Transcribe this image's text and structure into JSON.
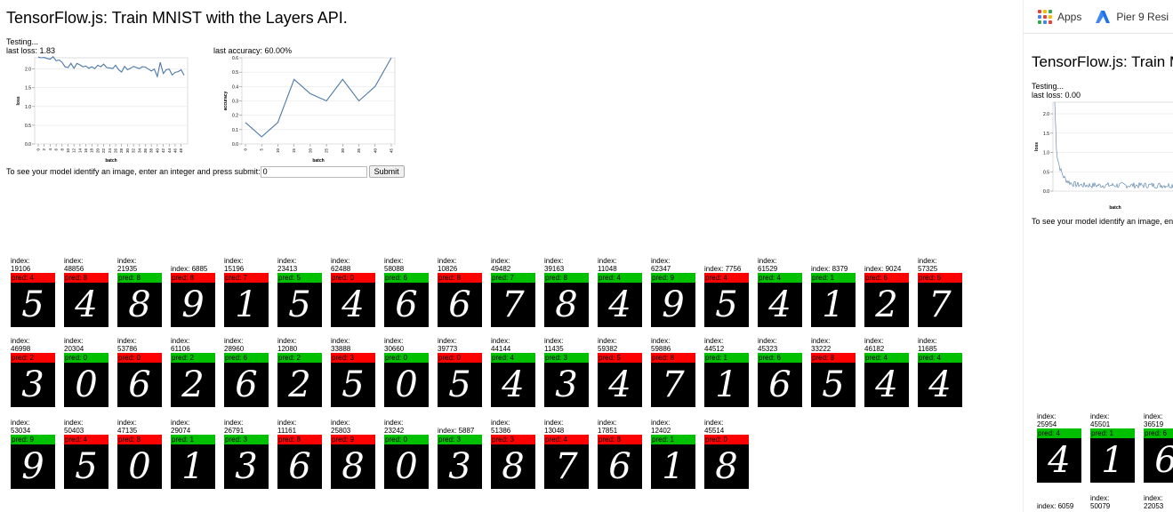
{
  "title": "TensorFlow.js: Train MNIST with the Layers API.",
  "status_text": "Testing...",
  "loss_label": "last loss: 1.83",
  "accuracy_label": "last accuracy: 60.00%",
  "prompt_text": "To see your model identify an image, enter an integer and press submit:",
  "index_input": {
    "value": "0"
  },
  "submit_label": "Submit",
  "chart_data": [
    {
      "type": "line",
      "title": "",
      "xlabel": "batch",
      "ylabel": "loss",
      "ylim": [
        0,
        2.3
      ],
      "yticks": [
        "0.0",
        "0.5",
        "1.0",
        "1.5",
        "2.0"
      ],
      "xticks": [
        "0",
        "2",
        "4",
        "6",
        "8",
        "10",
        "12",
        "14",
        "16",
        "18",
        "20",
        "22",
        "24",
        "26",
        "28",
        "30",
        "32",
        "34",
        "36",
        "38",
        "40",
        "42",
        "44",
        "46",
        "48"
      ],
      "x": [
        0,
        1,
        2,
        3,
        4,
        5,
        6,
        7,
        8,
        9,
        10,
        11,
        12,
        13,
        14,
        15,
        16,
        17,
        18,
        19,
        20,
        21,
        22,
        23,
        24,
        25,
        26,
        27,
        28,
        29,
        30,
        31,
        32,
        33,
        34,
        35,
        36,
        37,
        38,
        39,
        40,
        41,
        42,
        43,
        44,
        45,
        46,
        47,
        48,
        49
      ],
      "values": [
        2.32,
        2.3,
        2.31,
        2.28,
        2.26,
        2.33,
        2.22,
        2.24,
        2.18,
        2.06,
        2.04,
        2.15,
        2.02,
        2.15,
        2.11,
        2.06,
        2.08,
        2.02,
        2.06,
        2.01,
        2.1,
        2.06,
        2.13,
        2.04,
        2.03,
        2.01,
        2.1,
        1.98,
        1.92,
        2.07,
        1.98,
        2.02,
        2.07,
        2.04,
        2.01,
        2.06,
        2.05,
        2.0,
        1.95,
        2.0,
        1.8,
        2.18,
        1.88,
        1.98,
        2.0,
        1.84,
        1.91,
        1.93,
        1.98,
        1.83
      ]
    },
    {
      "type": "line",
      "title": "",
      "xlabel": "batch",
      "ylabel": "accuracy",
      "ylim": [
        0,
        0.6
      ],
      "yticks": [
        "0.0",
        "0.1",
        "0.2",
        "0.3",
        "0.4",
        "0.5",
        "0.6"
      ],
      "xticks": [
        "0",
        "5",
        "10",
        "15",
        "20",
        "25",
        "30",
        "35",
        "40",
        "45"
      ],
      "x": [
        0,
        5,
        10,
        15,
        20,
        25,
        30,
        35,
        40,
        45
      ],
      "values": [
        0.15,
        0.05,
        0.15,
        0.45,
        0.35,
        0.3,
        0.45,
        0.3,
        0.4,
        0.6
      ]
    },
    {
      "type": "line",
      "title": "",
      "xlabel": "batch",
      "ylabel": "loss",
      "ylim": [
        0,
        2.3
      ],
      "yticks": [
        "0.0",
        "0.5",
        "1.0",
        "1.5",
        "2.0"
      ],
      "note": ""
    }
  ],
  "examples": [
    {
      "index": "19106",
      "pred": "pred: 4",
      "correct": false,
      "digit": "5"
    },
    {
      "index": "48856",
      "pred": "pred: 8",
      "correct": false,
      "digit": "4"
    },
    {
      "index": "21935",
      "pred": "pred: 8",
      "correct": true,
      "digit": "8"
    },
    {
      "index": "6885",
      "pred": "pred: 8",
      "correct": false,
      "digit": "9"
    },
    {
      "index": "15196",
      "pred": "pred: 7",
      "correct": false,
      "digit": "1"
    },
    {
      "index": "23413",
      "pred": "pred: 5",
      "correct": true,
      "digit": "5"
    },
    {
      "index": "62488",
      "pred": "pred: 0",
      "correct": false,
      "digit": "4"
    },
    {
      "index": "58088",
      "pred": "pred: 6",
      "correct": true,
      "digit": "6"
    },
    {
      "index": "10826",
      "pred": "pred: 8",
      "correct": false,
      "digit": "6"
    },
    {
      "index": "49482",
      "pred": "pred: 7",
      "correct": true,
      "digit": "7"
    },
    {
      "index": "39163",
      "pred": "pred: 8",
      "correct": true,
      "digit": "8"
    },
    {
      "index": "11048",
      "pred": "pred: 4",
      "correct": true,
      "digit": "4"
    },
    {
      "index": "62347",
      "pred": "pred: 9",
      "correct": true,
      "digit": "9"
    },
    {
      "index": "7756",
      "pred": "pred: 4",
      "correct": false,
      "digit": "5"
    },
    {
      "index": "61529",
      "pred": "pred: 4",
      "correct": true,
      "digit": "4"
    },
    {
      "index": "8379",
      "pred": "pred: 1",
      "correct": true,
      "digit": "1"
    },
    {
      "index": "9024",
      "pred": "pred: 6",
      "correct": false,
      "digit": "2"
    },
    {
      "index": "57325",
      "pred": "pred: 6",
      "correct": false,
      "digit": "7"
    },
    {
      "index": "46998",
      "pred": "pred: 2",
      "correct": false,
      "digit": "3"
    },
    {
      "index": "20304",
      "pred": "pred: 0",
      "correct": true,
      "digit": "0"
    },
    {
      "index": "53786",
      "pred": "pred: 0",
      "correct": false,
      "digit": "6"
    },
    {
      "index": "61106",
      "pred": "pred: 2",
      "correct": true,
      "digit": "2"
    },
    {
      "index": "28960",
      "pred": "pred: 6",
      "correct": true,
      "digit": "6"
    },
    {
      "index": "12080",
      "pred": "pred: 2",
      "correct": true,
      "digit": "2"
    },
    {
      "index": "33888",
      "pred": "pred: 3",
      "correct": false,
      "digit": "5"
    },
    {
      "index": "30660",
      "pred": "pred: 0",
      "correct": true,
      "digit": "0"
    },
    {
      "index": "39773",
      "pred": "pred: 0",
      "correct": false,
      "digit": "5"
    },
    {
      "index": "44144",
      "pred": "pred: 4",
      "correct": true,
      "digit": "4"
    },
    {
      "index": "11435",
      "pred": "pred: 3",
      "correct": true,
      "digit": "3"
    },
    {
      "index": "59382",
      "pred": "pred: 5",
      "correct": false,
      "digit": "4"
    },
    {
      "index": "59886",
      "pred": "pred: 8",
      "correct": false,
      "digit": "7"
    },
    {
      "index": "44512",
      "pred": "pred: 1",
      "correct": true,
      "digit": "1"
    },
    {
      "index": "45323",
      "pred": "pred: 6",
      "correct": true,
      "digit": "6"
    },
    {
      "index": "33222",
      "pred": "pred: 8",
      "correct": false,
      "digit": "5"
    },
    {
      "index": "46182",
      "pred": "pred: 4",
      "correct": true,
      "digit": "4"
    },
    {
      "index": "11685",
      "pred": "pred: 4",
      "correct": true,
      "digit": "4"
    },
    {
      "index": "53034",
      "pred": "pred: 9",
      "correct": true,
      "digit": "9"
    },
    {
      "index": "50403",
      "pred": "pred: 4",
      "correct": false,
      "digit": "5"
    },
    {
      "index": "47135",
      "pred": "pred: 8",
      "correct": false,
      "digit": "0"
    },
    {
      "index": "29074",
      "pred": "pred: 1",
      "correct": true,
      "digit": "1"
    },
    {
      "index": "26791",
      "pred": "pred: 3",
      "correct": true,
      "digit": "3"
    },
    {
      "index": "11161",
      "pred": "pred: 8",
      "correct": false,
      "digit": "6"
    },
    {
      "index": "25803",
      "pred": "pred: 9",
      "correct": false,
      "digit": "8"
    },
    {
      "index": "23242",
      "pred": "pred: 0",
      "correct": true,
      "digit": "0"
    },
    {
      "index": "5887",
      "pred": "pred: 3",
      "correct": true,
      "digit": "3"
    },
    {
      "index": "51386",
      "pred": "pred: 3",
      "correct": false,
      "digit": "8"
    },
    {
      "index": "13048",
      "pred": "pred: 4",
      "correct": false,
      "digit": "7"
    },
    {
      "index": "17851",
      "pred": "pred: 8",
      "correct": false,
      "digit": "6"
    },
    {
      "index": "12402",
      "pred": "pred: 1",
      "correct": true,
      "digit": "1"
    },
    {
      "index": "45514",
      "pred": "pred: 0",
      "correct": false,
      "digit": "8"
    }
  ],
  "right_pane": {
    "bookmarks": [
      {
        "label": "Apps",
        "icon": "apps-grid-icon"
      },
      {
        "label": "Pier 9 Resi",
        "icon": "pier9-logo-icon"
      }
    ],
    "title": "TensorFlow.js: Train M",
    "status_text": "Testing...",
    "loss_label": "last loss: 0.00",
    "prompt_text": "To see your model identify an image, en",
    "examples": [
      {
        "index": "25954",
        "pred": "pred: 4",
        "correct": true,
        "digit": "4"
      },
      {
        "index": "45501",
        "pred": "pred: 1",
        "correct": true,
        "digit": "1"
      },
      {
        "index": "36519",
        "pred": "pred: 6",
        "correct": true,
        "digit": "6"
      }
    ],
    "examples_row2": [
      {
        "index": "6059"
      },
      {
        "index": "50079"
      },
      {
        "index": "22053"
      }
    ]
  },
  "colors": {
    "line": "#4c78a8",
    "correct": "#00c000",
    "wrong": "#ff0000",
    "grid": "#e6e6e6"
  }
}
